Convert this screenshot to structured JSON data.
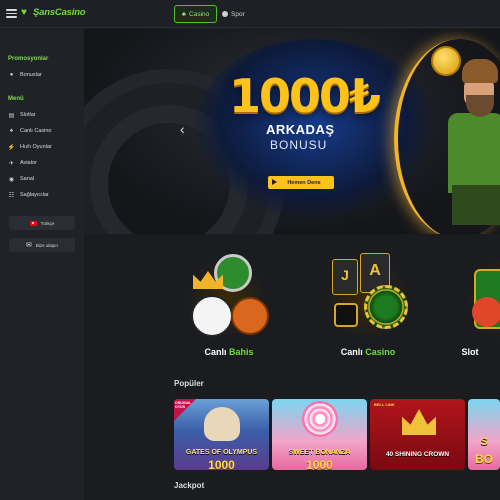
{
  "topbar": {
    "brand": "ŞansCasino",
    "tabs": [
      {
        "label": "Casino",
        "active": true
      },
      {
        "label": "Spor",
        "active": false
      }
    ]
  },
  "sidebar": {
    "promotions_heading": "Promosyonlar",
    "promotions": [
      {
        "label": "Bonuslar",
        "icon": "gift-icon"
      }
    ],
    "menu_heading": "Menü",
    "items": [
      {
        "label": "Slotlar",
        "icon": "slot-icon"
      },
      {
        "label": "Canlı Casino",
        "icon": "cards-icon"
      },
      {
        "label": "Hızlı Oyunlar",
        "icon": "lightning-icon"
      },
      {
        "label": "Aviator",
        "icon": "plane-icon"
      },
      {
        "label": "Sanal",
        "icon": "globe-icon"
      },
      {
        "label": "Sağlayıcılar",
        "icon": "providers-icon"
      }
    ],
    "language_button": "Türkçe",
    "contact_button": "Bize ulaşın"
  },
  "banner": {
    "amount": "1000₺",
    "line1": "ARKADAŞ",
    "line2": "BONUSU",
    "cta": "Hemen Dene"
  },
  "categories": [
    {
      "label_a": "Canlı",
      "label_b": "Bahis"
    },
    {
      "label_a": "Canlı",
      "label_b": "Casino"
    },
    {
      "label_a": "Slot",
      "label_b": ""
    }
  ],
  "sections": {
    "popular": "Popüler",
    "jackpot": "Jackpot"
  },
  "games": [
    {
      "title": "GATES OF OLYMPUS",
      "sub": "1000",
      "badge": "ORIJINAL OYUN"
    },
    {
      "title": "SWEET BONANZA",
      "sub": "1000",
      "badge": ""
    },
    {
      "title": "40 SHINING CROWN",
      "sub": "",
      "badge": "BELL LINK"
    },
    {
      "title": "S",
      "sub": "BO",
      "badge": ""
    }
  ],
  "colors": {
    "accent": "#6fdc3c",
    "gold": "#ffc21a",
    "bg": "#1a1c20"
  }
}
